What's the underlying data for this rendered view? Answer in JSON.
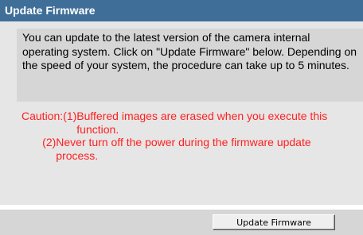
{
  "header": {
    "title": "Update Firmware"
  },
  "info": {
    "text": "You can update to the latest version of the camera internal operating system. Click on \"Update Firmware\" below. Depending on the speed of your system, the procedure can take up to 5 minutes."
  },
  "caution": {
    "label": "Caution:",
    "items": [
      {
        "number": "(1)",
        "text": "Buffered images are erased when you execute this function."
      },
      {
        "number": "(2)",
        "text": "Never turn off the power during the firmware update process."
      }
    ]
  },
  "actions": {
    "update_firmware_label": "Update Firmware"
  },
  "colors": {
    "title_bar": "#3f6f99",
    "panel": "#e6e6e6",
    "info_box": "#d6d6d6",
    "caution_text": "#ff1f1f"
  }
}
